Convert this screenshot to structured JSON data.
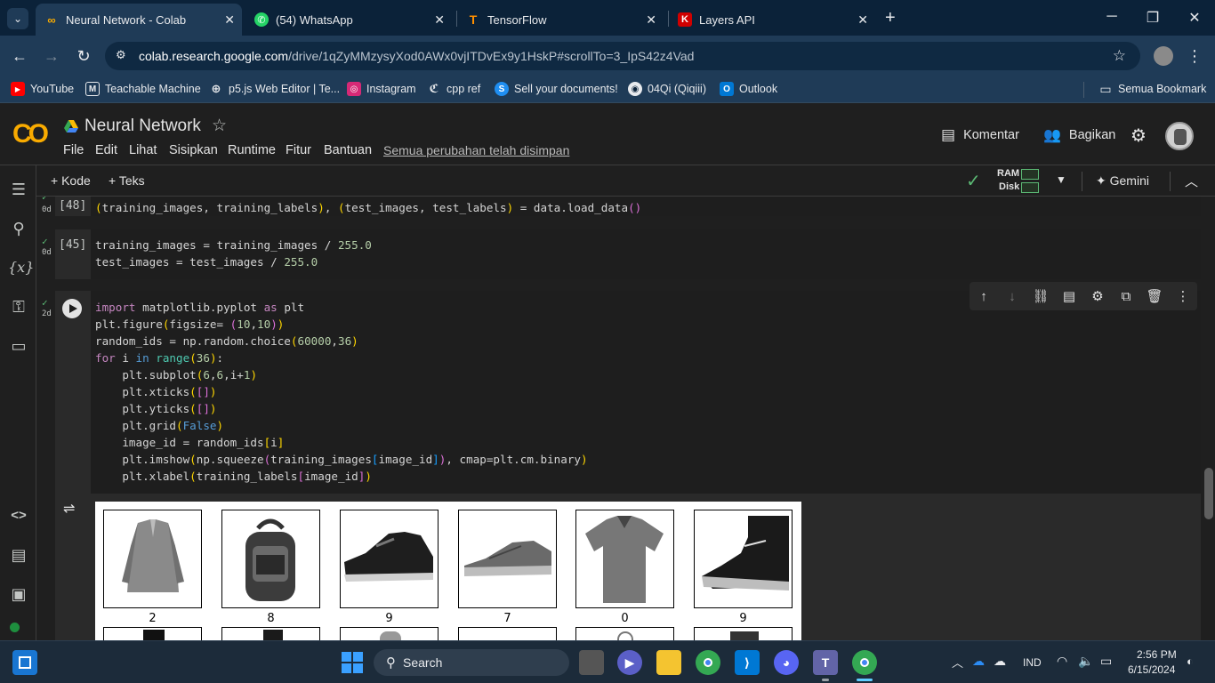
{
  "browser": {
    "tabs": [
      {
        "title": "Neural Network - Colab",
        "active": true,
        "icon": "colab-icon"
      },
      {
        "title": "(54) WhatsApp",
        "active": false,
        "icon": "whatsapp-icon"
      },
      {
        "title": "TensorFlow",
        "active": false,
        "icon": "tensorflow-icon"
      },
      {
        "title": "Layers API",
        "active": false,
        "icon": "keras-icon"
      }
    ],
    "url_host": "colab.research.google.com",
    "url_path": "/drive/1qZyMMzysyXod0AWx0vjITDvEx9y1HskP#scrollTo=3_IpS42z4Vad",
    "bookmarks": [
      "YouTube",
      "Teachable Machine",
      "p5.js Web Editor | Te...",
      "Instagram",
      "cpp ref",
      "Sell your documents!",
      "04Qi (Qiqiii)",
      "Outlook"
    ],
    "all_bookmarks": "Semua Bookmark"
  },
  "colab": {
    "logo": "CO",
    "title": "Neural Network",
    "menu": [
      "File",
      "Edit",
      "Lihat",
      "Sisipkan",
      "Runtime",
      "Fitur",
      "Bantuan"
    ],
    "save_status": "Semua perubahan telah disimpan",
    "comment_label": "Komentar",
    "share_label": "Bagikan",
    "add_code": "Kode",
    "add_text": "Teks",
    "ram_label": "RAM",
    "disk_label": "Disk",
    "gemini_label": "Gemini"
  },
  "cells": {
    "cell1": {
      "exec": "[48]",
      "status": "0d",
      "line1": "(training_images, training_labels), (test_images, test_labels) = data.load_data()"
    },
    "cell2": {
      "exec": "[45]",
      "status": "0d"
    },
    "cell3": {
      "status": "2d"
    }
  },
  "output": {
    "labels_row1": [
      "2",
      "8",
      "9",
      "7",
      "0",
      "9"
    ]
  },
  "taskbar": {
    "search": "Search",
    "language": "IND",
    "time": "2:56 PM",
    "date": "6/15/2024"
  }
}
